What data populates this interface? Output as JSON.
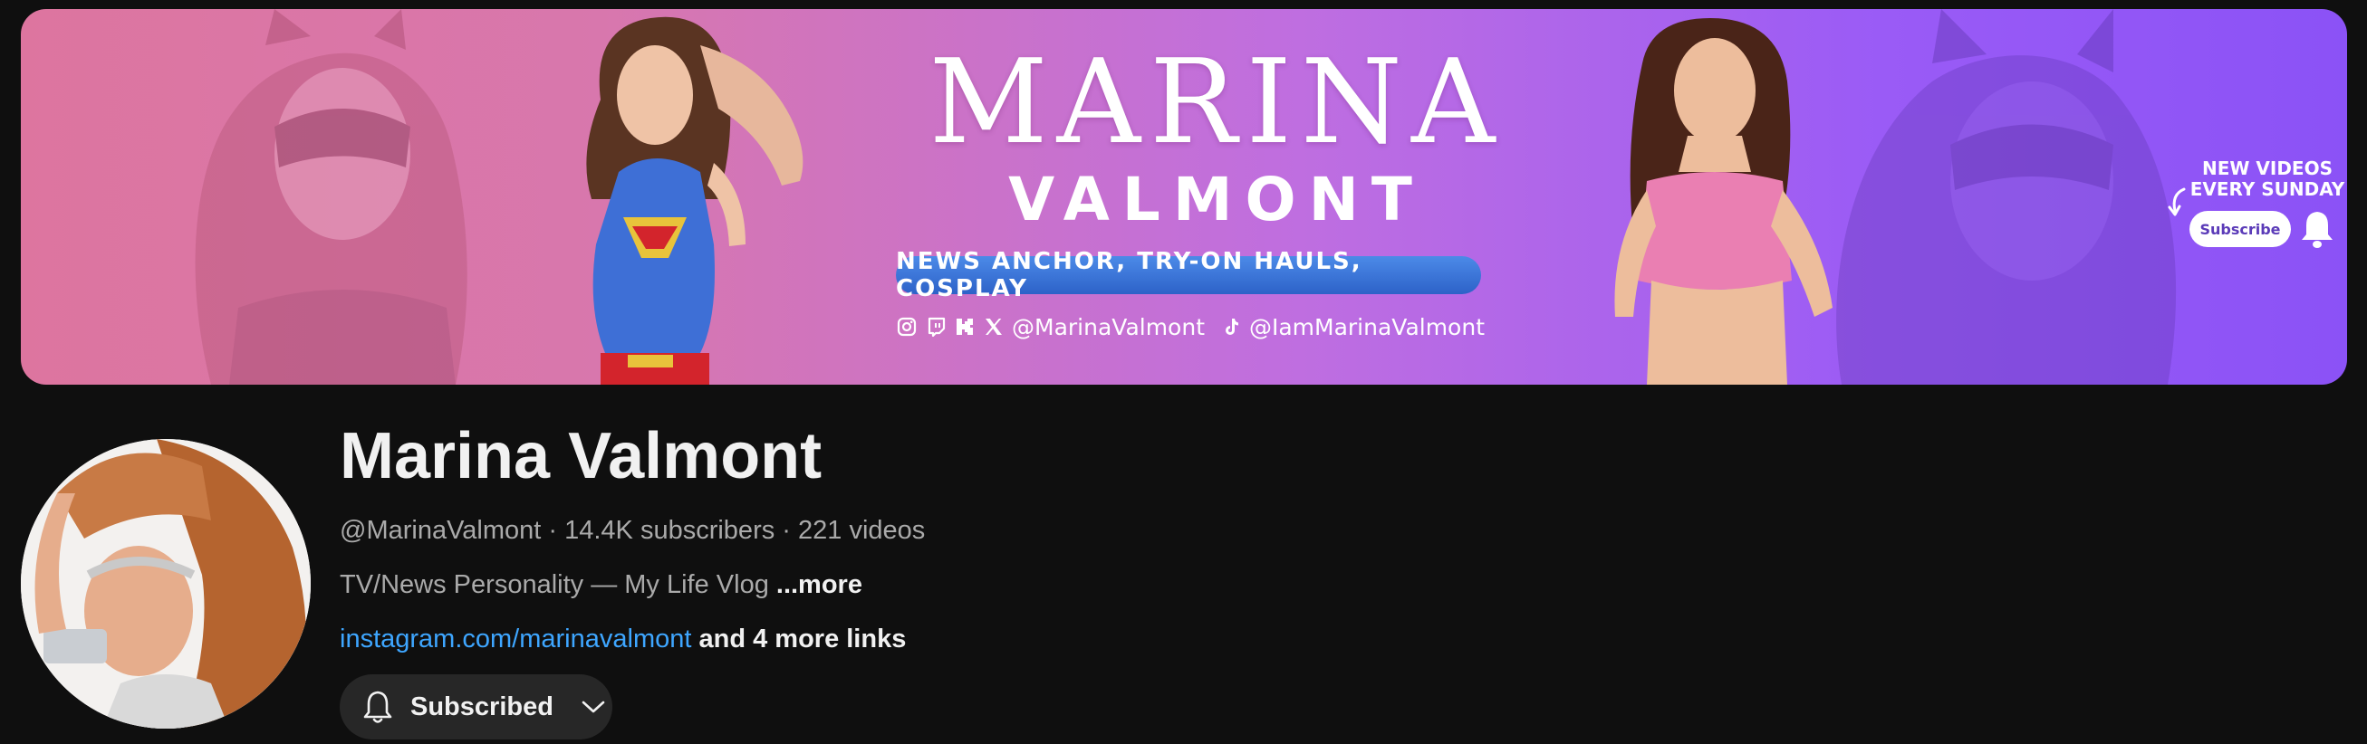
{
  "banner": {
    "brand_top": "MARINA",
    "brand_bottom": "VALMONT",
    "tagline": "NEWS ANCHOR, TRY-ON HAULS, COSPLAY",
    "social_handle_main": "@MarinaValmont",
    "social_handle_tiktok": "@IamMarinaValmont",
    "social_icons": [
      "instagram-icon",
      "twitch-icon",
      "kick-icon",
      "x-icon",
      "tiktok-icon"
    ],
    "promo_line1": "NEW VIDEOS",
    "promo_line2": "EVERY SUNDAY",
    "promo_subscribe": "Subscribe",
    "colors": {
      "gradient_start": "#dd759f",
      "gradient_end": "#8b52f6",
      "pill": "#2d62c8"
    }
  },
  "channel": {
    "name": "Marina Valmont",
    "handle": "@MarinaValmont",
    "separator": " · ",
    "subscribers": "14.4K subscribers",
    "videos": "221 videos",
    "description": "TV/News Personality — My Life Vlog ",
    "more_label": "...more",
    "primary_link": "instagram.com/marinavalmont",
    "more_links": " and 4 more links",
    "subscribe_state": "Subscribed",
    "link_color": "#3ea6ff"
  }
}
